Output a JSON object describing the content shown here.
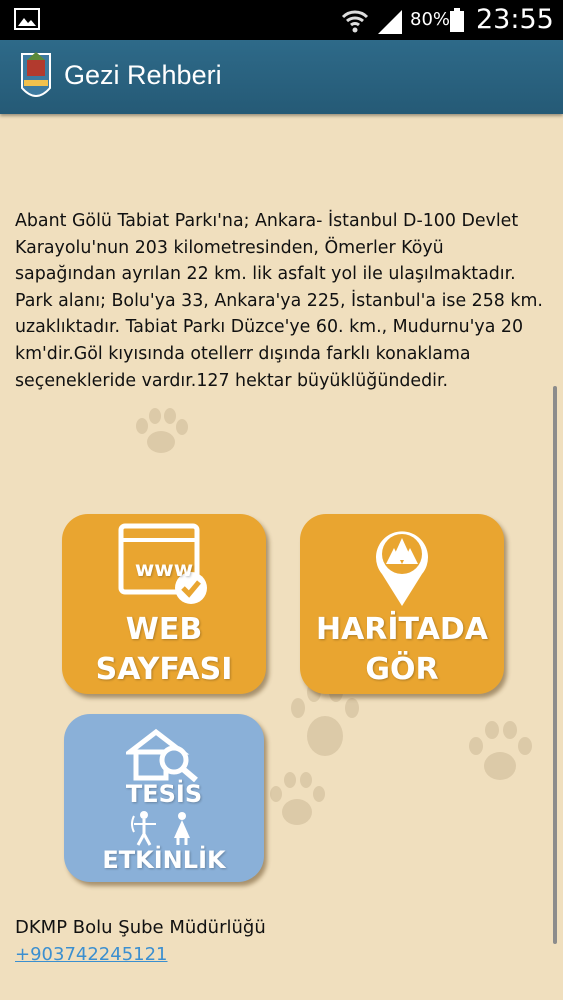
{
  "status_bar": {
    "battery_percent": "80%",
    "time": "23:55",
    "icons": [
      "image-notification-icon",
      "wifi-icon",
      "cell-signal-icon",
      "battery-icon"
    ]
  },
  "action_bar": {
    "title": "Gezi Rehberi",
    "logo": "app-logo-icon"
  },
  "main": {
    "description": "Abant Gölü Tabiat Parkı'na; Ankara- İstanbul D-100 Devlet Karayolu'nun 203 kilometresinden, Ömerler Köyü sapağından ayrılan 22 km. lik asfalt yol ile ulaşılmaktadır. Park alanı; Bolu'ya 33, Ankara'ya 225, İstanbul'a ise 258 km. uzaklıktadır. Tabiat Parkı Düzce'ye 60. km., Mudurnu'ya 20 km'dir.Göl kıyısında otellerr dışında farklı konaklama seçenekleride vardır.127 hektar büyüklüğündedir.",
    "tiles": {
      "web": {
        "line1": "WEB",
        "line2": "SAYFASI",
        "icon_text": "www",
        "color": "#E9A530"
      },
      "map": {
        "line1": "HARİTADA",
        "line2": "GÖR",
        "color": "#E9A530"
      },
      "facility": {
        "line1": "TESİS",
        "line2": "ETKİNLİK",
        "color": "#8AB0D8"
      }
    },
    "footer": {
      "name": "DKMP Bolu Şube Müdürlüğü",
      "phone": "+903742245121"
    }
  },
  "colors": {
    "background": "#F0DFBE",
    "action_bar": "#2E6A89",
    "link": "#3B8FD0"
  }
}
